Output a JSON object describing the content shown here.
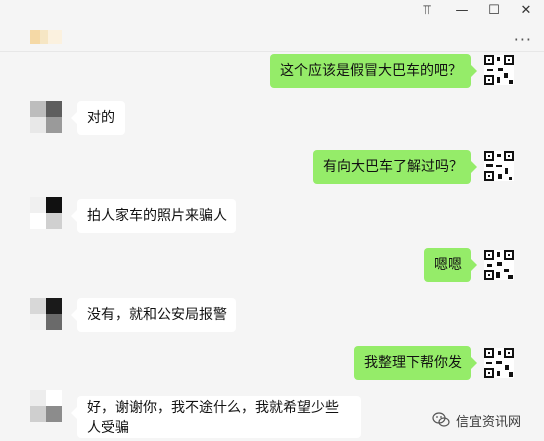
{
  "window_controls": {
    "pin_glyph": "⫪",
    "minimize_glyph": "—",
    "maximize_glyph": "☐",
    "close_glyph": "✕"
  },
  "header": {
    "more_glyph": "···"
  },
  "messages": [
    {
      "side": "me",
      "text": "这个应该是假冒大巴车的吧？"
    },
    {
      "side": "them",
      "text": "对的"
    },
    {
      "side": "me",
      "text": "有向大巴车了解过吗？"
    },
    {
      "side": "them",
      "text": "拍人家车的照片来骗人"
    },
    {
      "side": "me",
      "text": "嗯嗯"
    },
    {
      "side": "them",
      "text": "没有，就和公安局报警"
    },
    {
      "side": "me",
      "text": "我整理下帮你发"
    },
    {
      "side": "them",
      "text": "好，谢谢你，我不途什么，我就希望少些人受骗"
    }
  ],
  "watermark": {
    "label": "信宜资讯网"
  },
  "colors": {
    "sent_bubble": "#95ec69",
    "received_bubble": "#ffffff",
    "background": "#f5f5f5"
  }
}
